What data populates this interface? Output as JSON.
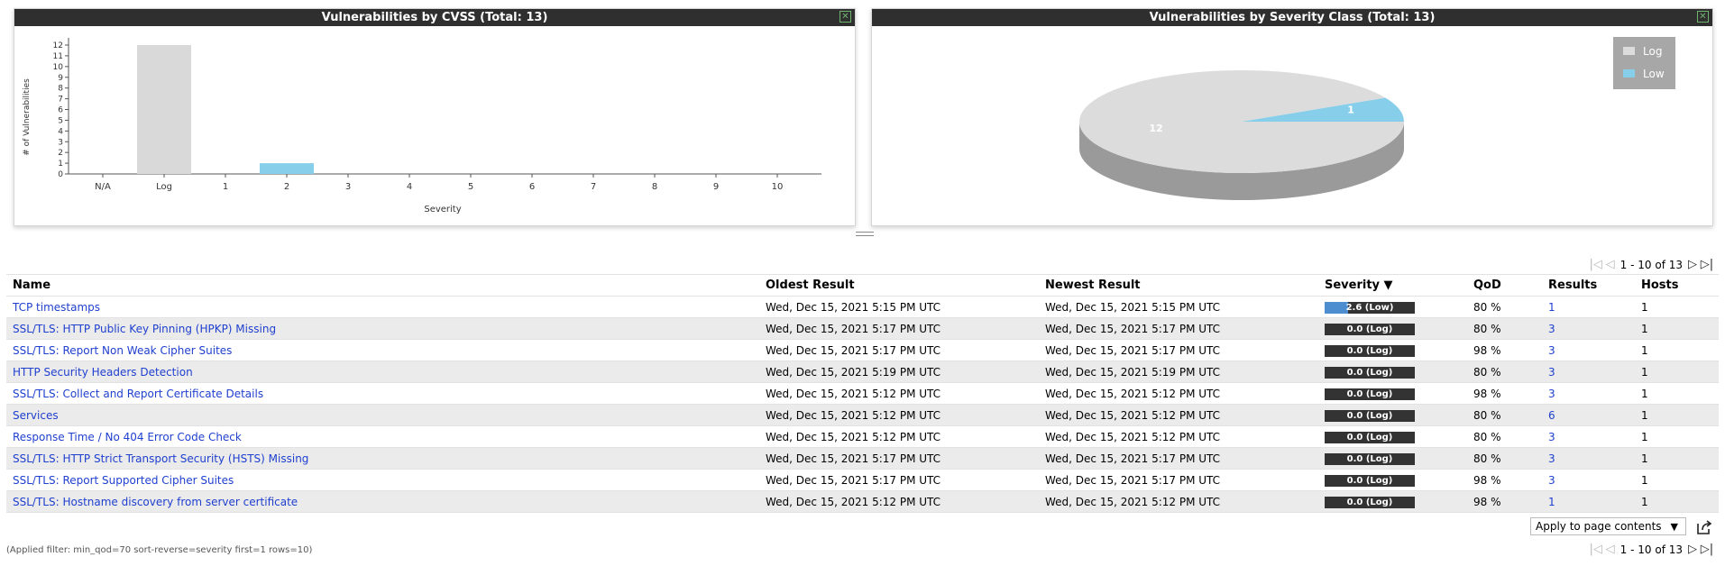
{
  "cvss_panel": {
    "title": "Vulnerabilities by CVSS (Total: 13)",
    "chart_data": {
      "type": "bar",
      "title": "Vulnerabilities by CVSS (Total: 13)",
      "xlabel": "Severity",
      "ylabel": "# of Vulnerabilities",
      "categories": [
        "N/A",
        "Log",
        "1",
        "2",
        "3",
        "4",
        "5",
        "6",
        "7",
        "8",
        "9",
        "10"
      ],
      "values": [
        0,
        12,
        0,
        1,
        0,
        0,
        0,
        0,
        0,
        0,
        0,
        0
      ],
      "colors": [
        "#d9d9d9",
        "#d9d9d9",
        "#d9d9d9",
        "#87ceeb",
        "#d9d9d9",
        "#d9d9d9",
        "#d9d9d9",
        "#d9d9d9",
        "#d9d9d9",
        "#d9d9d9",
        "#d9d9d9",
        "#d9d9d9"
      ],
      "ylim": [
        0,
        12
      ],
      "yticks": [
        "0",
        "1",
        "2",
        "3",
        "4",
        "5",
        "6",
        "7",
        "8",
        "9",
        "10",
        "11",
        "12"
      ]
    }
  },
  "severity_panel": {
    "title": "Vulnerabilities by Severity Class (Total: 13)",
    "chart_data": {
      "type": "pie",
      "title": "Vulnerabilities by Severity Class (Total: 13)",
      "slices": [
        {
          "label": "Log",
          "value": 12,
          "color": "#dcdcdc"
        },
        {
          "label": "Low",
          "value": 1,
          "color": "#87ceeb"
        }
      ],
      "legend_position": "top-right"
    }
  },
  "pager": {
    "count_text": "1 - 10 of 13"
  },
  "table": {
    "headers": {
      "name": "Name",
      "oldest": "Oldest Result",
      "newest": "Newest Result",
      "severity": "Severity ▼",
      "qod": "QoD",
      "results": "Results",
      "hosts": "Hosts"
    },
    "rows": [
      {
        "name": "TCP timestamps",
        "oldest": "Wed, Dec 15, 2021 5:15 PM UTC",
        "newest": "Wed, Dec 15, 2021 5:15 PM UTC",
        "severity": "2.6 (Low)",
        "severity_level": 0.26,
        "qod": "80 %",
        "results": "1",
        "hosts": "1"
      },
      {
        "name": "SSL/TLS: HTTP Public Key Pinning (HPKP) Missing",
        "oldest": "Wed, Dec 15, 2021 5:17 PM UTC",
        "newest": "Wed, Dec 15, 2021 5:17 PM UTC",
        "severity": "0.0 (Log)",
        "severity_level": 0,
        "qod": "80 %",
        "results": "3",
        "hosts": "1"
      },
      {
        "name": "SSL/TLS: Report Non Weak Cipher Suites",
        "oldest": "Wed, Dec 15, 2021 5:17 PM UTC",
        "newest": "Wed, Dec 15, 2021 5:17 PM UTC",
        "severity": "0.0 (Log)",
        "severity_level": 0,
        "qod": "98 %",
        "results": "3",
        "hosts": "1"
      },
      {
        "name": "HTTP Security Headers Detection",
        "oldest": "Wed, Dec 15, 2021 5:19 PM UTC",
        "newest": "Wed, Dec 15, 2021 5:19 PM UTC",
        "severity": "0.0 (Log)",
        "severity_level": 0,
        "qod": "80 %",
        "results": "3",
        "hosts": "1"
      },
      {
        "name": "SSL/TLS: Collect and Report Certificate Details",
        "oldest": "Wed, Dec 15, 2021 5:12 PM UTC",
        "newest": "Wed, Dec 15, 2021 5:12 PM UTC",
        "severity": "0.0 (Log)",
        "severity_level": 0,
        "qod": "98 %",
        "results": "3",
        "hosts": "1"
      },
      {
        "name": "Services",
        "oldest": "Wed, Dec 15, 2021 5:12 PM UTC",
        "newest": "Wed, Dec 15, 2021 5:12 PM UTC",
        "severity": "0.0 (Log)",
        "severity_level": 0,
        "qod": "80 %",
        "results": "6",
        "hosts": "1"
      },
      {
        "name": "Response Time / No 404 Error Code Check",
        "oldest": "Wed, Dec 15, 2021 5:12 PM UTC",
        "newest": "Wed, Dec 15, 2021 5:12 PM UTC",
        "severity": "0.0 (Log)",
        "severity_level": 0,
        "qod": "80 %",
        "results": "3",
        "hosts": "1"
      },
      {
        "name": "SSL/TLS: HTTP Strict Transport Security (HSTS) Missing",
        "oldest": "Wed, Dec 15, 2021 5:17 PM UTC",
        "newest": "Wed, Dec 15, 2021 5:17 PM UTC",
        "severity": "0.0 (Log)",
        "severity_level": 0,
        "qod": "80 %",
        "results": "3",
        "hosts": "1"
      },
      {
        "name": "SSL/TLS: Report Supported Cipher Suites",
        "oldest": "Wed, Dec 15, 2021 5:17 PM UTC",
        "newest": "Wed, Dec 15, 2021 5:17 PM UTC",
        "severity": "0.0 (Log)",
        "severity_level": 0,
        "qod": "98 %",
        "results": "3",
        "hosts": "1"
      },
      {
        "name": "SSL/TLS: Hostname discovery from server certificate",
        "oldest": "Wed, Dec 15, 2021 5:12 PM UTC",
        "newest": "Wed, Dec 15, 2021 5:12 PM UTC",
        "severity": "0.0 (Log)",
        "severity_level": 0,
        "qod": "98 %",
        "results": "1",
        "hosts": "1"
      }
    ]
  },
  "footer": {
    "apply_select": "Apply to page contents",
    "export_icon": "export-icon",
    "filter_text": "(Applied filter: min_qod=70 sort-reverse=severity first=1 rows=10)"
  },
  "colors": {
    "header": "#2f2f2f",
    "bar_log": "#d9d9d9",
    "bar_low": "#87ceeb",
    "link": "#1f3fcf",
    "sev_fill": "#4c8ed0"
  }
}
